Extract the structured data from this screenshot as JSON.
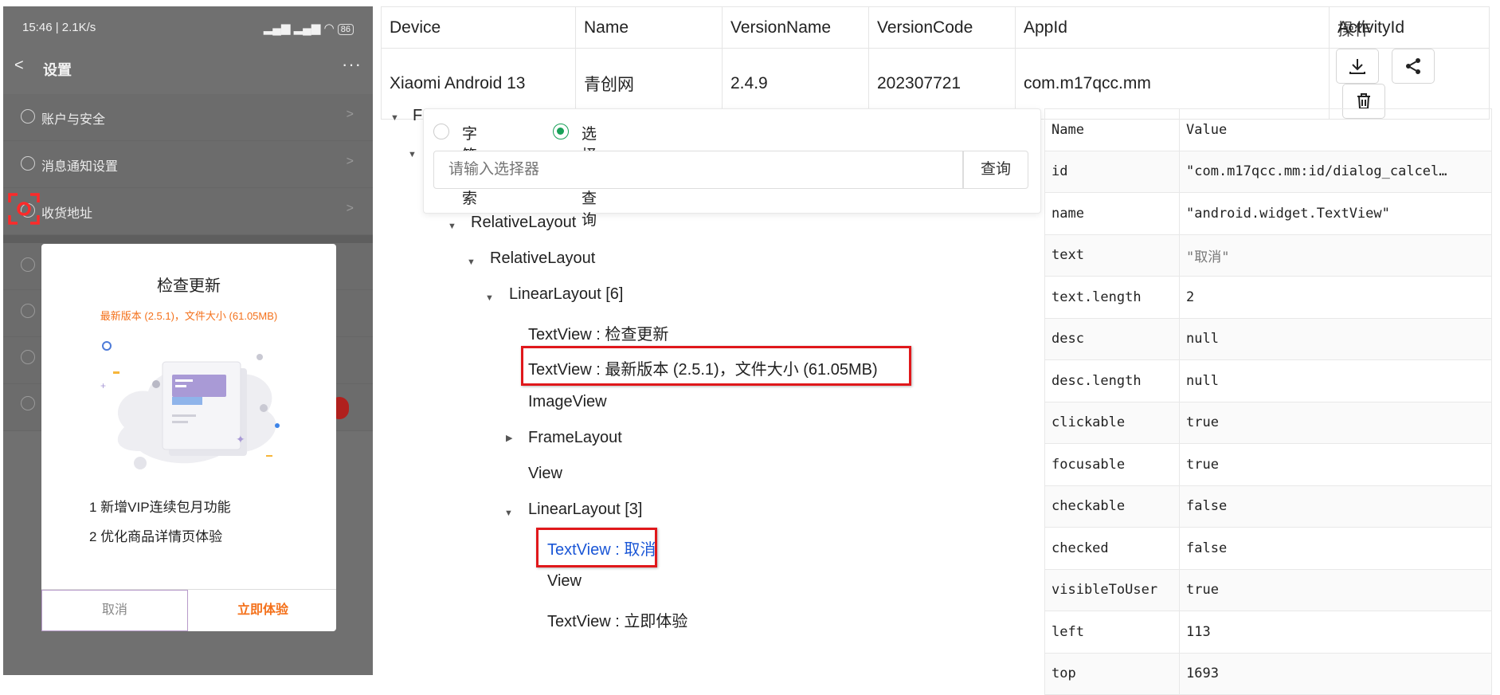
{
  "phone": {
    "status_time": "15:46 | 2.1K/s",
    "battery": "86",
    "nav_back": "<",
    "nav_title": "设置",
    "nav_more": "···",
    "menu_items": [
      "账户与安全",
      "消息通知设置",
      "收货地址"
    ],
    "arrow": ">"
  },
  "dialog": {
    "title": "检查更新",
    "subtitle": "最新版本 (2.5.1)，文件大小 (61.05MB)",
    "notes": [
      "1  新增VIP连续包月功能",
      "2  优化商品详情页体验"
    ],
    "cancel": "取消",
    "confirm": "立即体验"
  },
  "device_table": {
    "headers": [
      "Device",
      "Name",
      "VersionName",
      "VersionCode",
      "AppId",
      "ActivityId",
      "操作"
    ],
    "row": [
      "Xiaomi Android 13",
      "青创网",
      "2.4.9",
      "202307721",
      "com.m17qcc.mm",
      ""
    ]
  },
  "search": {
    "mode_text": "字符搜索",
    "mode_selector": "选择器查询",
    "placeholder": "请输入选择器",
    "button": "查询"
  },
  "tree": {
    "root_fragment": "F",
    "nodes": [
      "RelativeLayout",
      "RelativeLayout",
      "LinearLayout [6]",
      "TextView : 检查更新",
      "TextView : 最新版本 (2.5.1)，文件大小 (61.05MB)",
      "ImageView",
      "FrameLayout",
      "View",
      "LinearLayout [3]",
      "TextView : 取消",
      "View",
      "TextView : 立即体验"
    ]
  },
  "attributes": {
    "headers": [
      "Name",
      "Value"
    ],
    "rows": [
      [
        "id",
        "\"com.m17qcc.mm:id/dialog_calcel…"
      ],
      [
        "name",
        "\"android.widget.TextView\""
      ],
      [
        "text",
        "\"取消\""
      ],
      [
        "text.length",
        "2"
      ],
      [
        "desc",
        "null"
      ],
      [
        "desc.length",
        "null"
      ],
      [
        "clickable",
        "true"
      ],
      [
        "focusable",
        "true"
      ],
      [
        "checkable",
        "false"
      ],
      [
        "checked",
        "false"
      ],
      [
        "visibleToUser",
        "true"
      ],
      [
        "left",
        "113"
      ],
      [
        "top",
        "1693"
      ]
    ]
  },
  "colors": {
    "accent": "#18a058",
    "highlight": "#e0181b",
    "selected": "#1a56d6",
    "dialog_orange": "#f4711b"
  }
}
